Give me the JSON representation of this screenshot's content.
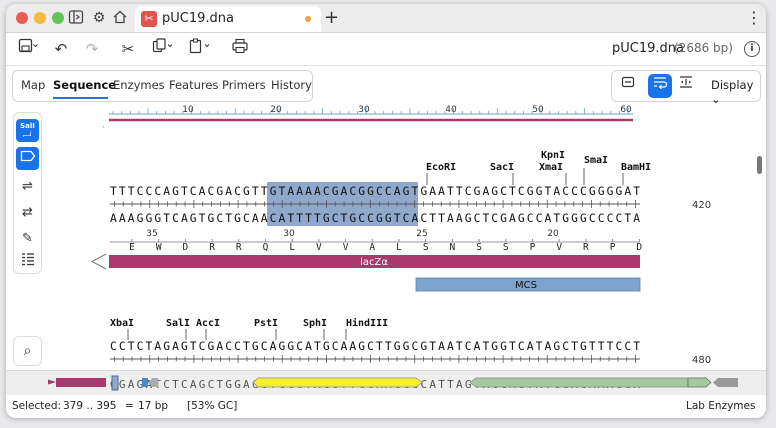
{
  "tab": {
    "title": "pUC19.dna",
    "icon": "snapgene-icon"
  },
  "toolbar": {
    "doc_name": "pUC19.dna",
    "doc_size": "(2686 bp)"
  },
  "view_tabs": [
    "Map",
    "Sequence",
    "Enzymes",
    "Features",
    "Primers",
    "History"
  ],
  "active_tab": "Sequence",
  "display_label": "Display",
  "ruler": {
    "labels": [
      "10",
      "20",
      "30",
      "40",
      "50",
      "60"
    ]
  },
  "block1": {
    "enzymes": [
      "EcoRI",
      "SacI",
      "KpnI",
      "XmaI",
      "SmaI",
      "BamHI"
    ],
    "top_seq": "TTTCCCAGTCACGACGTTGTAAAACGACGGCCAGTGAATTCGAGCTCGGTACCCGGGGAT",
    "bottom_seq": "AAAGGGTCAGTGCTGCAACATTTTGCTGCCGGTCACTTAAGCTCGAGCCATGGGCCCCTA",
    "position": "420",
    "aa_numbers": [
      "35",
      "30",
      "25",
      "20"
    ],
    "amino_acids": [
      "E",
      "W",
      "D",
      "R",
      "R",
      "Q",
      "L",
      "V",
      "V",
      "A",
      "L",
      "S",
      "N",
      "S",
      "S",
      "P",
      "V",
      "R",
      "P",
      "D"
    ],
    "features": [
      {
        "name": "lacZα",
        "color": "#a8396a"
      },
      {
        "name": "MCS",
        "color": "#7ea3cf"
      }
    ]
  },
  "block2": {
    "enzymes": [
      "XbaI",
      "SalI",
      "AccI",
      "PstI",
      "SphI",
      "HindIII"
    ],
    "top_seq": "CCTCTAGAGTCGACCTGCAGGCATGCAAGCTTGGCGTAATCATGGTCATAGCTGTTTCCT",
    "bottom_seq": "GGAGATCTCAGCTGGACGTCCGTACGTTCGAACCGCATTAGTACCAGTATCGACAAAGGA",
    "position": "480"
  },
  "sidebar": {
    "sali_label": "SalI"
  },
  "status": {
    "selected_label": "Selected:",
    "selected_range": "379 .. 395",
    "equals": "=",
    "length": "17 bp",
    "gc": "[53% GC]",
    "enzyme_set": "Lab Enzymes"
  },
  "colors": {
    "accent": "#1a73e8",
    "selection": "#8fa8cc",
    "lacz": "#a8396a",
    "mcs": "#7ea3cf",
    "yellow_feature": "#f4f12c",
    "green_feature": "#a5c8a1"
  }
}
